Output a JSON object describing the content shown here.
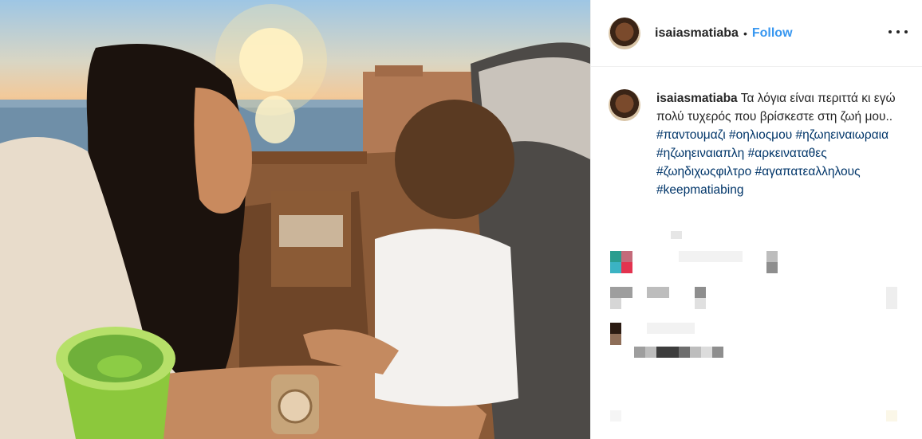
{
  "post": {
    "username": "isaiasmatiaba",
    "separator": "•",
    "follow_label": "Follow",
    "more_icon": "more-options-icon",
    "caption": {
      "username": "isaiasmatiaba",
      "text": "Τα λόγια είναι περιττά κι εγώ πολύ τυχερός που βρίσκεστε στη ζωή μου..",
      "hashtags": [
        "#παντουμαζι",
        "#οηλιοςμου",
        "#ηζωηειναιωραια",
        "#ηζωηειναιαπλη",
        "#αρκειναταθες",
        "#ζωηδιχωςφιλτρο",
        "#αγαπατεαλληλους",
        "#keepmatiabing"
      ]
    },
    "photo_description_icon": "photo-image",
    "colors": {
      "follow": "#3897f0",
      "hashtag": "#003569",
      "text": "#262626",
      "divider": "#efefef"
    }
  }
}
